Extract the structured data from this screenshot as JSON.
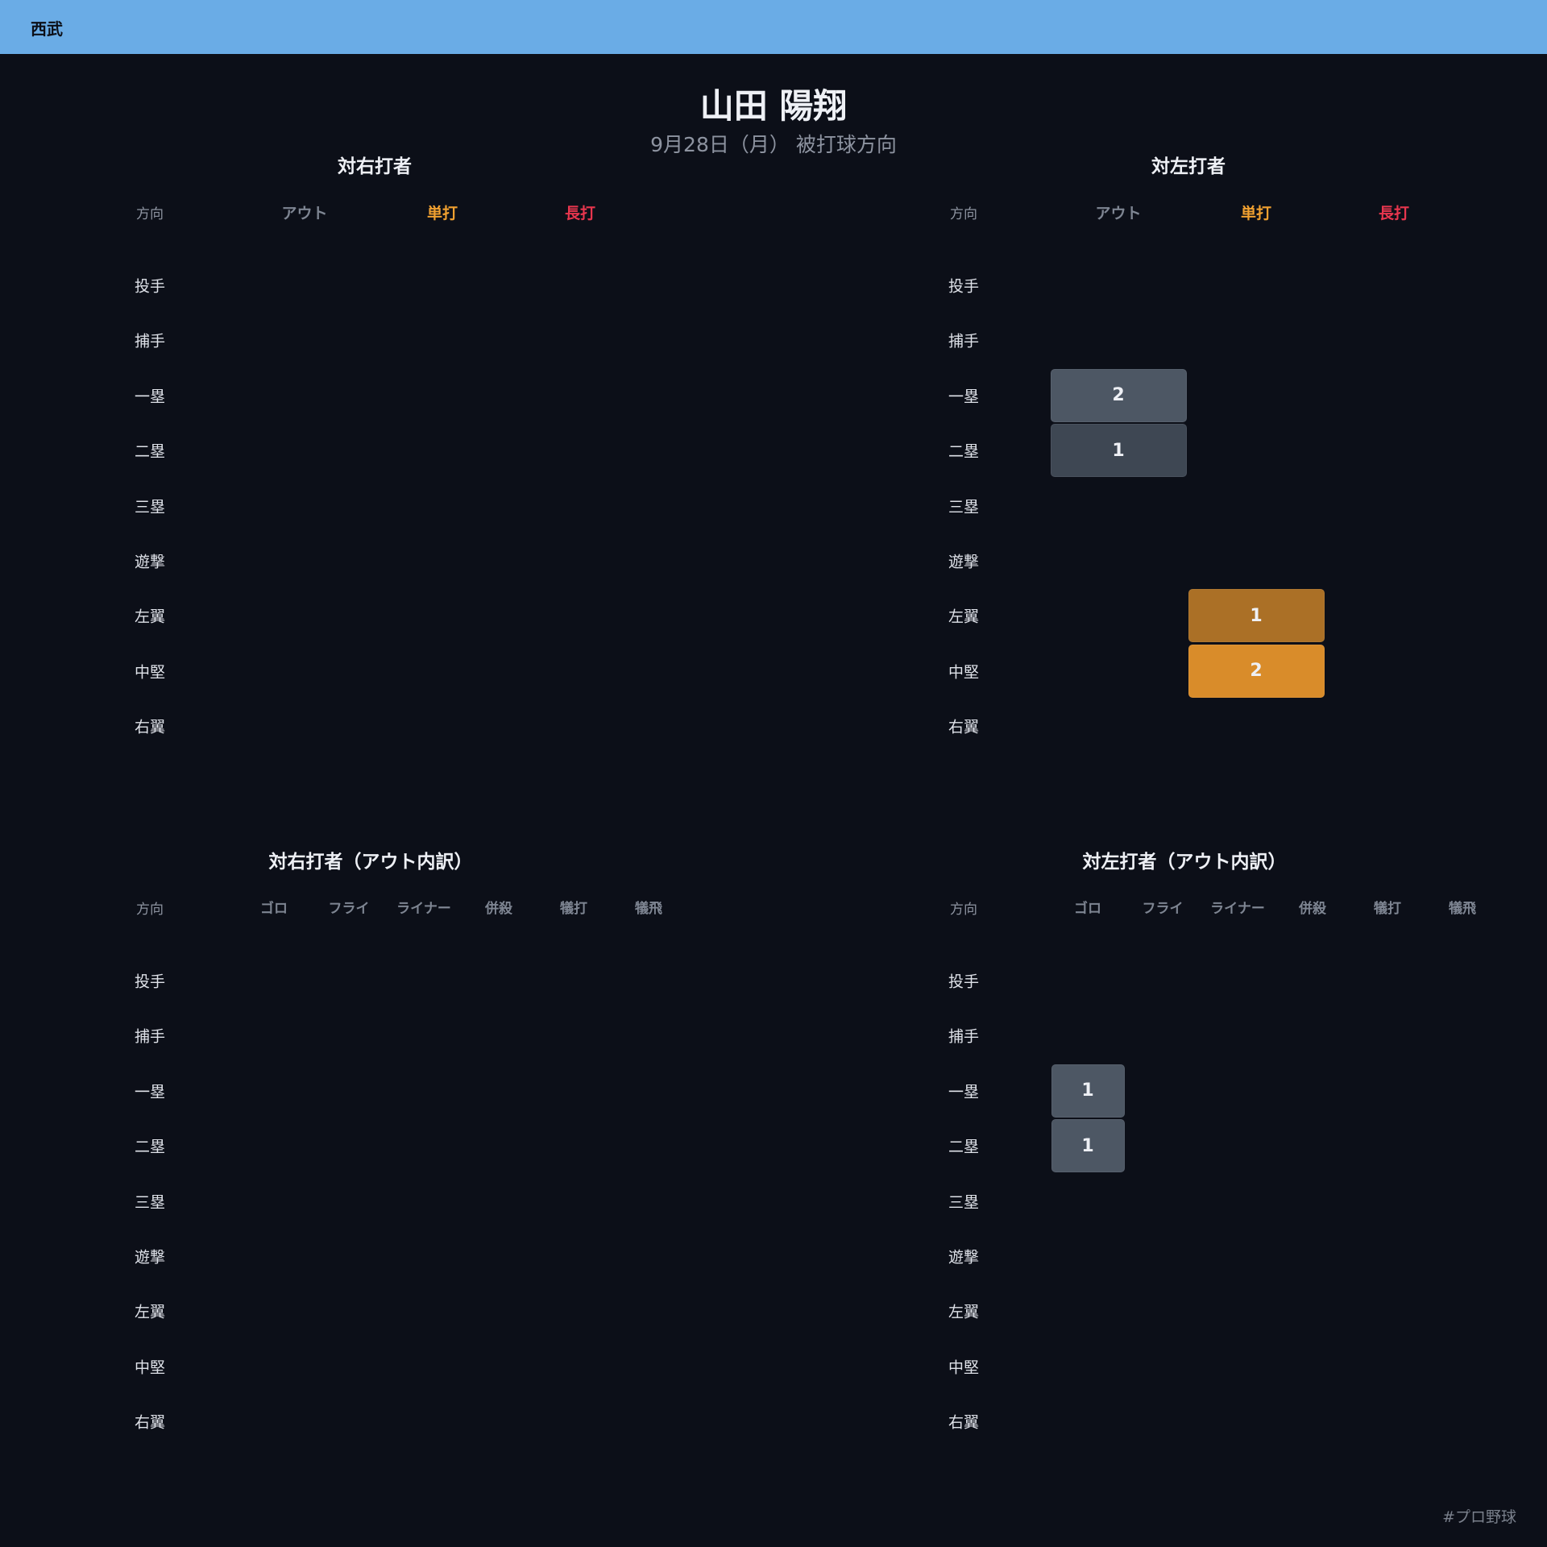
{
  "header": {
    "team": "西武"
  },
  "title": "山田 陽翔",
  "subtitle": "9月28日（月） 被打球方向",
  "footer": {
    "hashtag": "#プロ野球"
  },
  "colors": {
    "out": "#7e8592",
    "single": "#f0a030",
    "long": "#e8364e",
    "outCell": "#4d5764",
    "singleCell": "#d98c2a"
  },
  "chart_data": [
    {
      "type": "table",
      "title": "対右打者",
      "dir_header": "方向",
      "columns": [
        "アウト",
        "単打",
        "長打"
      ],
      "rows": [
        "投手",
        "捕手",
        "一塁",
        "二塁",
        "三塁",
        "遊撃",
        "左翼",
        "中堅",
        "右翼"
      ],
      "values": [
        [
          0,
          0,
          0
        ],
        [
          0,
          0,
          0
        ],
        [
          0,
          0,
          0
        ],
        [
          0,
          0,
          0
        ],
        [
          0,
          0,
          0
        ],
        [
          0,
          0,
          0
        ],
        [
          0,
          0,
          0
        ],
        [
          0,
          0,
          0
        ],
        [
          0,
          0,
          0
        ]
      ]
    },
    {
      "type": "table",
      "title": "対左打者",
      "dir_header": "方向",
      "columns": [
        "アウト",
        "単打",
        "長打"
      ],
      "rows": [
        "投手",
        "捕手",
        "一塁",
        "二塁",
        "三塁",
        "遊撃",
        "左翼",
        "中堅",
        "右翼"
      ],
      "values": [
        [
          0,
          0,
          0
        ],
        [
          0,
          0,
          0
        ],
        [
          2,
          0,
          0
        ],
        [
          1,
          0,
          0
        ],
        [
          0,
          0,
          0
        ],
        [
          0,
          0,
          0
        ],
        [
          0,
          1,
          0
        ],
        [
          0,
          2,
          0
        ],
        [
          0,
          0,
          0
        ]
      ]
    },
    {
      "type": "table",
      "title": "対右打者（アウト内訳）",
      "dir_header": "方向",
      "columns": [
        "ゴロ",
        "フライ",
        "ライナー",
        "併殺",
        "犠打",
        "犠飛"
      ],
      "rows": [
        "投手",
        "捕手",
        "一塁",
        "二塁",
        "三塁",
        "遊撃",
        "左翼",
        "中堅",
        "右翼"
      ],
      "values": [
        [
          0,
          0,
          0,
          0,
          0,
          0
        ],
        [
          0,
          0,
          0,
          0,
          0,
          0
        ],
        [
          0,
          0,
          0,
          0,
          0,
          0
        ],
        [
          0,
          0,
          0,
          0,
          0,
          0
        ],
        [
          0,
          0,
          0,
          0,
          0,
          0
        ],
        [
          0,
          0,
          0,
          0,
          0,
          0
        ],
        [
          0,
          0,
          0,
          0,
          0,
          0
        ],
        [
          0,
          0,
          0,
          0,
          0,
          0
        ],
        [
          0,
          0,
          0,
          0,
          0,
          0
        ]
      ]
    },
    {
      "type": "table",
      "title": "対左打者（アウト内訳）",
      "dir_header": "方向",
      "columns": [
        "ゴロ",
        "フライ",
        "ライナー",
        "併殺",
        "犠打",
        "犠飛"
      ],
      "rows": [
        "投手",
        "捕手",
        "一塁",
        "二塁",
        "三塁",
        "遊撃",
        "左翼",
        "中堅",
        "右翼"
      ],
      "values": [
        [
          0,
          0,
          0,
          0,
          0,
          0
        ],
        [
          0,
          0,
          0,
          0,
          0,
          0
        ],
        [
          1,
          0,
          0,
          0,
          0,
          0
        ],
        [
          1,
          0,
          0,
          0,
          0,
          0
        ],
        [
          0,
          0,
          0,
          0,
          0,
          0
        ],
        [
          0,
          0,
          0,
          0,
          0,
          0
        ],
        [
          0,
          0,
          0,
          0,
          0,
          0
        ],
        [
          0,
          0,
          0,
          0,
          0,
          0
        ],
        [
          0,
          0,
          0,
          0,
          0,
          0
        ]
      ]
    }
  ]
}
